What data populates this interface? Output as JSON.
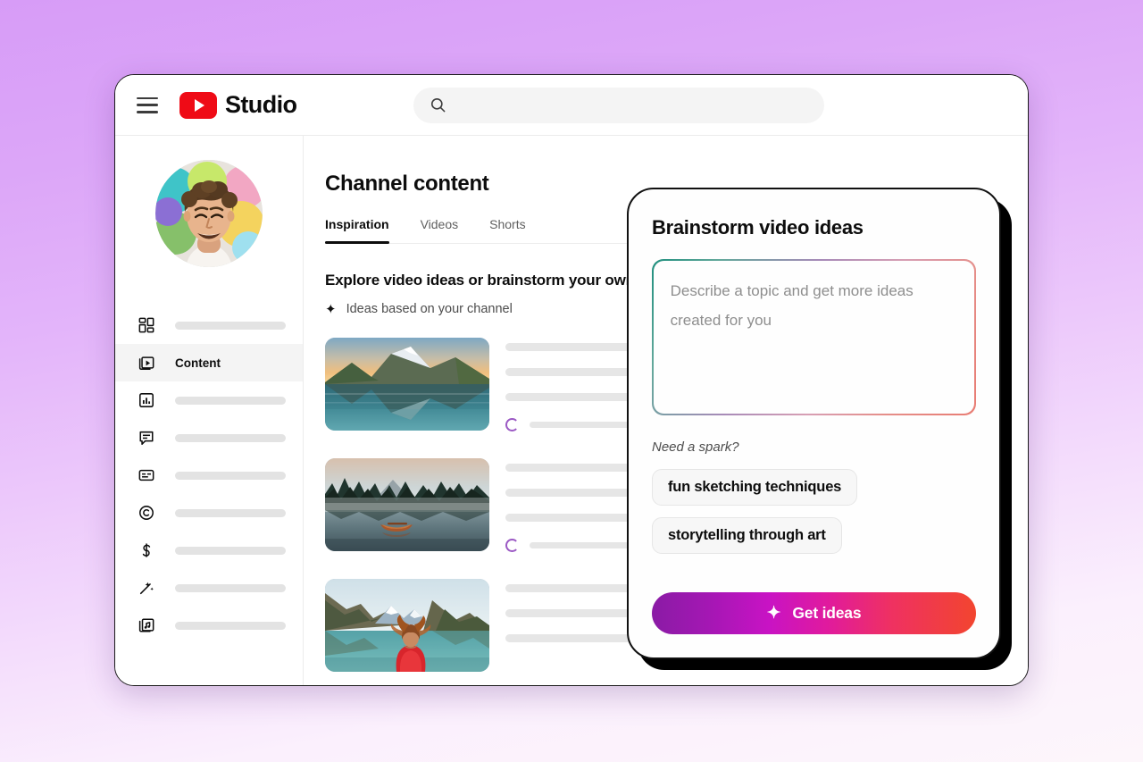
{
  "app": {
    "brand_word": "Studio",
    "logo_icon": "youtube-play-icon",
    "menu_icon": "hamburger-menu-icon"
  },
  "search": {
    "value": "",
    "placeholder": "",
    "icon": "search-icon"
  },
  "sidebar": {
    "avatar_alt": "channel-avatar",
    "items": [
      {
        "label": "",
        "icon": "dashboard-grid-icon",
        "active": false
      },
      {
        "label": "Content",
        "icon": "content-video-icon",
        "active": true
      },
      {
        "label": "",
        "icon": "analytics-bar-chart-icon",
        "active": false
      },
      {
        "label": "",
        "icon": "comments-speech-bubble-icon",
        "active": false
      },
      {
        "label": "",
        "icon": "subtitles-icon",
        "active": false
      },
      {
        "label": "",
        "icon": "copyright-icon",
        "active": false
      },
      {
        "label": "",
        "icon": "earn-dollar-icon",
        "active": false
      },
      {
        "label": "",
        "icon": "customization-magic-wand-icon",
        "active": false
      },
      {
        "label": "",
        "icon": "audio-library-music-icon",
        "active": false
      }
    ]
  },
  "main": {
    "page_title": "Channel content",
    "tabs": [
      {
        "label": "Inspiration",
        "active": true
      },
      {
        "label": "Videos",
        "active": false
      },
      {
        "label": "Shorts",
        "active": false
      }
    ],
    "explore_heading": "Explore video ideas or brainstorm your own",
    "explore_subtitle": "Ideas based on your channel",
    "subtitle_icon": "sparkle-icon",
    "ideas": [
      {
        "thumbnail": "mountain-peak-reflected-in-alpine-lake-at-sunset",
        "status_icon": "loading-ring-icon"
      },
      {
        "thumbnail": "wooden-canoe-on-misty-forest-lake-at-dawn",
        "status_icon": "loading-ring-icon"
      },
      {
        "thumbnail": "woman-in-red-jacket-facing-mountain-lake",
        "status_icon": "loading-ring-icon"
      }
    ]
  },
  "modal": {
    "title": "Brainstorm video ideas",
    "textarea_value": "",
    "textarea_placeholder": "Describe a topic and get more ideas created for you",
    "spark_label": "Need a spark?",
    "chips": [
      "fun sketching techniques",
      "storytelling through art"
    ],
    "cta_label": "Get ideas",
    "cta_icon": "sparkle-icon"
  },
  "colors": {
    "brand_red": "#ef0b16",
    "page_background_top": "#d79cf7",
    "page_background_bottom": "#fdf6fb",
    "cta_gradient_start": "#8a1ba5",
    "cta_gradient_end": "#f2452f",
    "textarea_border_start": "#1f8f7e",
    "textarea_border_end": "#e87c73",
    "accent_ring": "#9b59c4"
  }
}
